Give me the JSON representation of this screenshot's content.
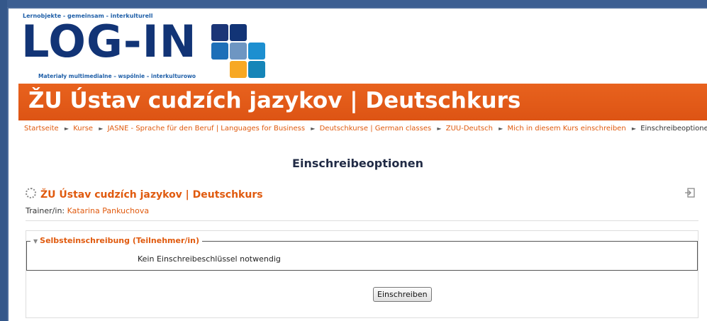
{
  "logo": {
    "tagline_top": "Lernobjekte - gemeinsam - interkulturell",
    "wordmark": "LOG-IN",
    "tagline_bottom": "Materiały multimedialne – wspólnie – interkulturowo",
    "tile_colors": [
      "#1b3577",
      "#123476",
      "#1d6fb8",
      "#6e96c2",
      "#1d8fd0",
      "#f7a823",
      "#1685b8"
    ]
  },
  "banner": {
    "title": "ŽU Ústav cudzích jazykov | Deutschkurs",
    "color": "#e05a0e"
  },
  "breadcrumb": [
    "Startseite",
    "Kurse",
    "JASNE - Sprache für den Beruf | Languages for Business",
    "Deutschkurse | German classes",
    "ZUU-Deutsch",
    "Mich in diesem Kurs einschreiben",
    "Einschreibeoptionen"
  ],
  "page_heading": "Einschreibeoptionen",
  "course": {
    "title": "ŽU Ústav cudzích jazykov | Deutschkurs",
    "trainer_label": "Trainer/in:",
    "trainer_name": "Katarina Pankuchova"
  },
  "self_enrolment": {
    "legend": "Selbsteinschreibung (Teilnehmer/in)",
    "note": "Kein Einschreibeschlüssel notwendig",
    "button_label": "Einschreiben"
  }
}
